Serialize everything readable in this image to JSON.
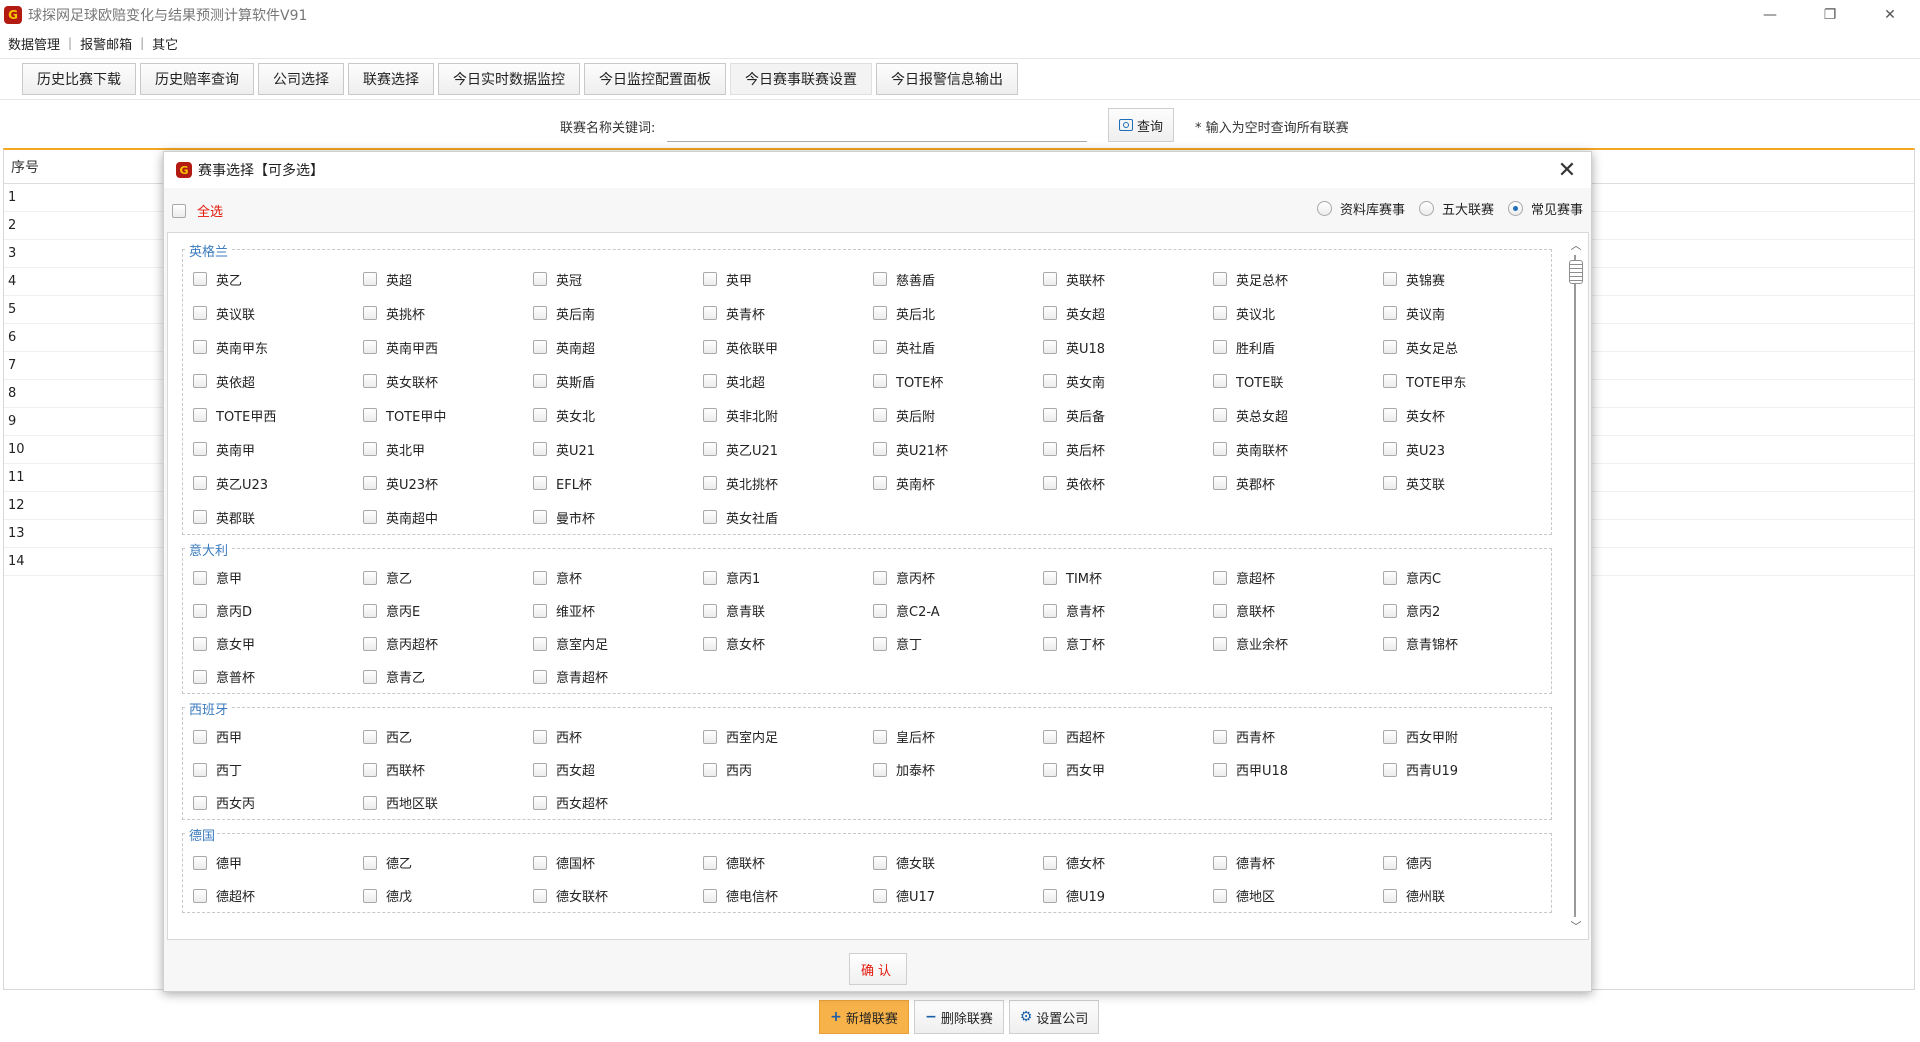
{
  "app": {
    "logo_glyph": "G",
    "title": "球探网足球欧赔变化与结果预测计算软件V91",
    "window_controls": [
      "—",
      "❐",
      "✕"
    ]
  },
  "menu": [
    "数据管理",
    "报警邮箱",
    "其它"
  ],
  "menu_separator": "|",
  "tabs": [
    {
      "label": "历史比赛下载",
      "active": false
    },
    {
      "label": "历史赔率查询",
      "active": false
    },
    {
      "label": "公司选择",
      "active": false
    },
    {
      "label": "联赛选择",
      "active": false
    },
    {
      "label": "今日实时数据监控",
      "active": false
    },
    {
      "label": "今日监控配置面板",
      "active": false
    },
    {
      "label": "今日赛事联赛设置",
      "active": true
    },
    {
      "label": "今日报警信息输出",
      "active": false
    }
  ],
  "search": {
    "label": "联赛名称关键词:",
    "value": "",
    "placeholder": "",
    "button": "查询",
    "hint": "* 输入为空时查询所有联赛"
  },
  "table": {
    "header": "序号",
    "rows": [
      "1",
      "2",
      "3",
      "4",
      "5",
      "6",
      "7",
      "8",
      "9",
      "10",
      "11",
      "12",
      "13",
      "14"
    ]
  },
  "bottom_buttons": [
    {
      "label": "新增联赛",
      "icon": "+"
    },
    {
      "label": "删除联赛",
      "icon": "−"
    },
    {
      "label": "设置公司",
      "icon": "⚙"
    }
  ],
  "colors": {
    "accent_orange": "#f5a623",
    "primary_button": "#f7b24a",
    "group_title": "#3b7bbf",
    "select_all_red": "#e3170a",
    "logo_red": "#b21a12"
  },
  "modal": {
    "logo_glyph": "G",
    "title": "赛事选择【可多选】",
    "close": "✕",
    "select_all": "全选",
    "radios": [
      {
        "label": "资料库赛事",
        "selected": false
      },
      {
        "label": "五大联赛",
        "selected": false
      },
      {
        "label": "常见赛事",
        "selected": true
      }
    ],
    "confirm": "确认",
    "groups": [
      {
        "name": "英格兰",
        "items": [
          "英乙",
          "英超",
          "英冠",
          "英甲",
          "慈善盾",
          "英联杯",
          "英足总杯",
          "英锦赛",
          "英议联",
          "英挑杯",
          "英后南",
          "英青杯",
          "英后北",
          "英女超",
          "英议北",
          "英议南",
          "英南甲东",
          "英南甲西",
          "英南超",
          "英依联甲",
          "英社盾",
          "英U18",
          "胜利盾",
          "英女足总",
          "英依超",
          "英女联杯",
          "英斯盾",
          "英北超",
          "TOTE杯",
          "英女南",
          "TOTE联",
          "TOTE甲东",
          "TOTE甲西",
          "TOTE甲中",
          "英女北",
          "英非北附",
          "英后附",
          "英后备",
          "英总女超",
          "英女杯",
          "英南甲",
          "英北甲",
          "英U21",
          "英乙U21",
          "英U21杯",
          "英后杯",
          "英南联杯",
          "英U23",
          "英乙U23",
          "英U23杯",
          "EFL杯",
          "英北挑杯",
          "英南杯",
          "英依杯",
          "英郡杯",
          "英艾联",
          "英郡联",
          "英南超中",
          "曼市杯",
          "英女社盾"
        ]
      },
      {
        "name": "意大利",
        "items": [
          "意甲",
          "意乙",
          "意杯",
          "意丙1",
          "意丙杯",
          "TIM杯",
          "意超杯",
          "意丙C",
          "意丙D",
          "意丙E",
          "维亚杯",
          "意青联",
          "意C2-A",
          "意青杯",
          "意联杯",
          "意丙2",
          "意女甲",
          "意丙超杯",
          "意室内足",
          "意女杯",
          "意丁",
          "意丁杯",
          "意业余杯",
          "意青锦杯",
          "意普杯",
          "意青乙",
          "意青超杯"
        ]
      },
      {
        "name": "西班牙",
        "items": [
          "西甲",
          "西乙",
          "西杯",
          "西室内足",
          "皇后杯",
          "西超杯",
          "西青杯",
          "西女甲附",
          "西丁",
          "西联杯",
          "西女超",
          "西丙",
          "加泰杯",
          "西女甲",
          "西甲U18",
          "西青U19",
          "西女丙",
          "西地区联",
          "西女超杯"
        ]
      },
      {
        "name": "德国",
        "items": [
          "德甲",
          "德乙",
          "德国杯",
          "德联杯",
          "德女联",
          "德女杯",
          "德青杯",
          "德丙",
          "德超杯",
          "德戊",
          "德女联杯",
          "德电信杯",
          "德U17",
          "德U19",
          "德地区",
          "德州联"
        ]
      }
    ]
  }
}
